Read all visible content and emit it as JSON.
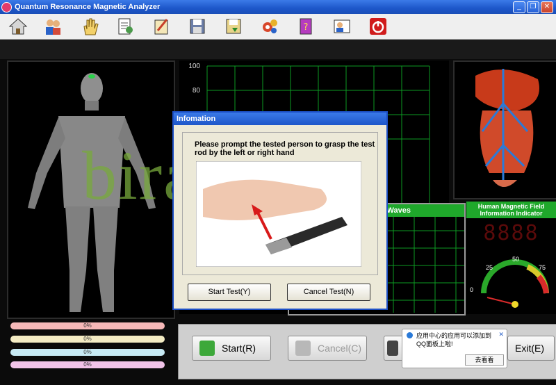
{
  "window": {
    "title": "Quantum Resonance Magnetic Analyzer",
    "min": "_",
    "restore": "❐",
    "close": "✕"
  },
  "toolbar": {
    "icons": [
      "home-icon",
      "users-icon",
      "hand-icon",
      "report-icon",
      "edit-report-icon",
      "save-icon",
      "save-as-icon",
      "settings-gears-icon",
      "help-book-icon",
      "user-info-icon",
      "power-icon"
    ]
  },
  "chart": {
    "ticks": [
      "100",
      "80"
    ],
    "grid_color": "#0d9a22"
  },
  "waves": {
    "label": "Information Waves"
  },
  "indicator": {
    "title": "Human Magnetic Field Information Indicator",
    "digits": "8888",
    "gauge_0": "0",
    "gauge_25": "25",
    "gauge_50": "50",
    "gauge_75": "75"
  },
  "progress": [
    {
      "label": "0%",
      "color": "#f5b8b8"
    },
    {
      "label": "0%",
      "color": "#f4ecc4"
    },
    {
      "label": "0%",
      "color": "#c7eaf4"
    },
    {
      "label": "0%",
      "color": "#f1c3e8"
    }
  ],
  "actions": {
    "start": "Start(R)",
    "cancel": "Cancel(C)",
    "exit": "Exit(E)"
  },
  "watermark": "birascan",
  "dialog": {
    "title": "Infomation",
    "message": "Please prompt the tested person to grasp the test rod by the left or right hand",
    "start_test": "Start Test(Y)",
    "cancel_test": "Cancel Test(N)"
  },
  "notification": {
    "text": "应用中心的应用可以添加到QQ面板上啦!",
    "button": "去看看",
    "close": "✕"
  }
}
